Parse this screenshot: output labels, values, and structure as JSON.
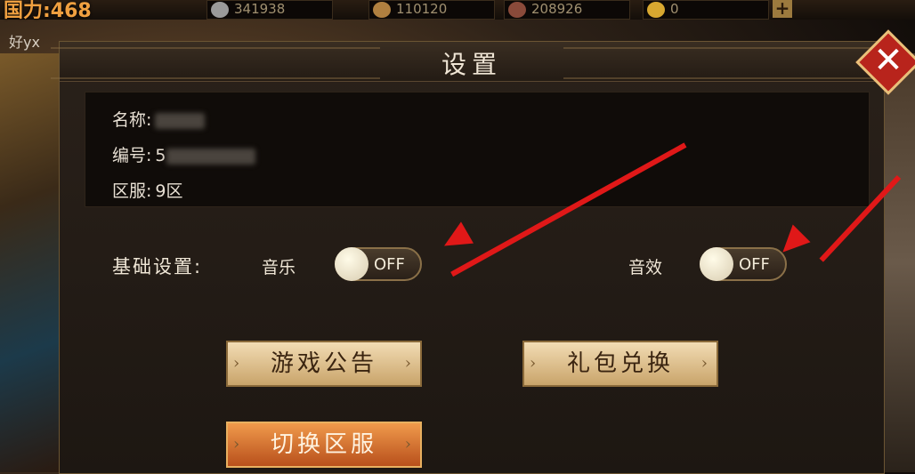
{
  "topbar": {
    "power": "国力:468",
    "resources": [
      {
        "icon": "silver-coin-icon",
        "value": "341938"
      },
      {
        "icon": "feather-icon",
        "value": "110120"
      },
      {
        "icon": "soldier-icon",
        "value": "208926"
      },
      {
        "icon": "gold-ingot-icon",
        "value": "0"
      }
    ],
    "add_label": "+"
  },
  "friend_label": "好yx",
  "settings": {
    "title": "设置",
    "close_label": "✕",
    "info": {
      "name_label": "名称:",
      "id_label": "编号:",
      "id_visible_prefix": "5",
      "server_label": "区服:",
      "server_value": "9区"
    },
    "basic_label": "基础设置:",
    "music_label": "音乐",
    "music_state": "OFF",
    "sfx_label": "音效",
    "sfx_state": "OFF",
    "buttons": {
      "announcement": "游戏公告",
      "gift_redeem": "礼包兑换",
      "switch_server": "切换区服"
    }
  },
  "colors": {
    "arrow": "#e01818",
    "close": "#b8241c",
    "accent_button": "#d8703a"
  }
}
